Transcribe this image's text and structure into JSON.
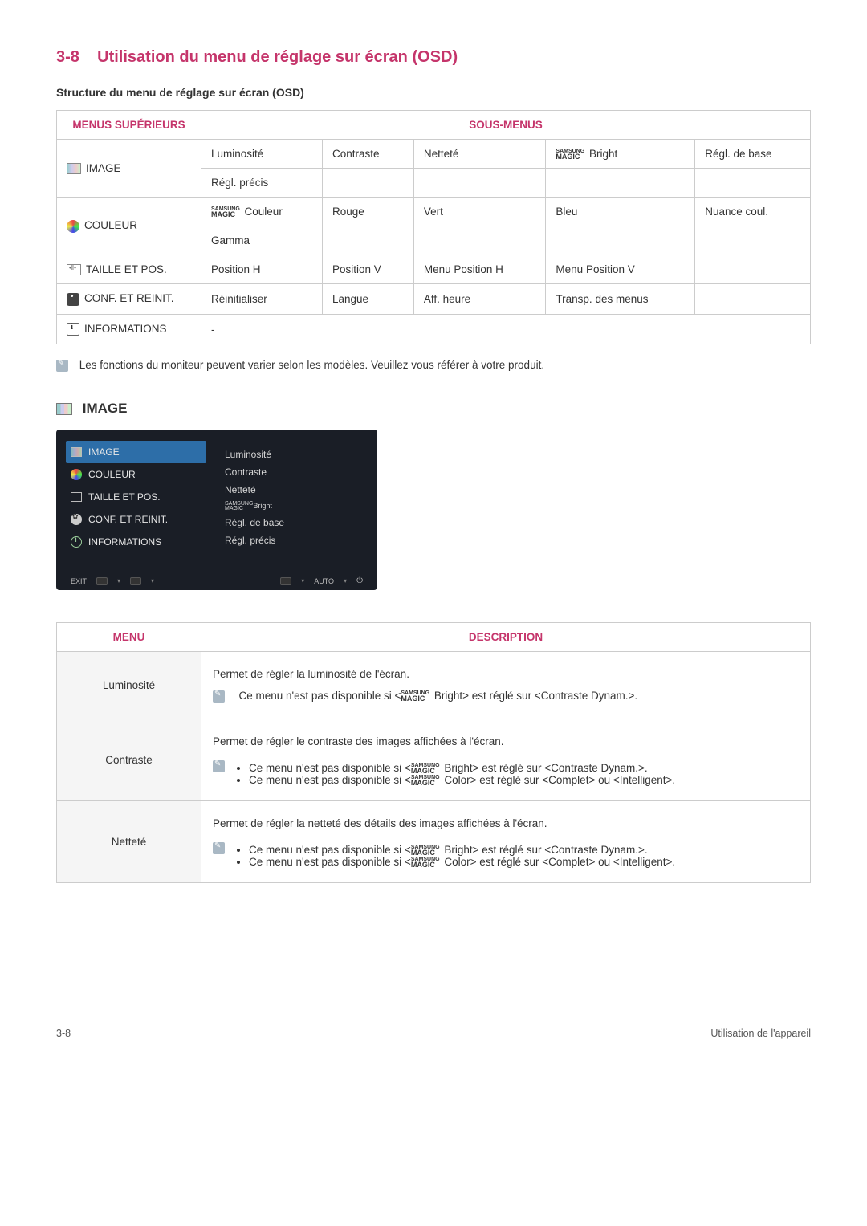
{
  "header": {
    "section_number": "3-8",
    "section_title": "Utilisation du menu de réglage sur écran (OSD)",
    "sub_heading": "Structure du menu de réglage sur écran (OSD)"
  },
  "table_headers": {
    "col1": "MENUS SUPÉRIEURS",
    "col2": "SOUS-MENUS"
  },
  "menus": {
    "image": {
      "label": "IMAGE",
      "row1": [
        "Luminosité",
        "Contraste",
        "Netteté",
        " Bright",
        "Régl. de base"
      ],
      "row2": [
        "Régl. précis",
        "",
        "",
        "",
        ""
      ]
    },
    "couleur": {
      "label": "COULEUR",
      "row1": [
        " Couleur",
        "Rouge",
        "Vert",
        "Bleu",
        "Nuance coul."
      ],
      "row2": [
        "Gamma",
        "",
        "",
        "",
        ""
      ]
    },
    "taille": {
      "label": "TAILLE ET POS.",
      "row1": [
        "Position H",
        "Position V",
        "Menu Position H",
        "Menu Position V",
        ""
      ]
    },
    "conf": {
      "label": "CONF. ET REINIT.",
      "row1": [
        "Réinitialiser",
        "Langue",
        "Aff. heure",
        "Transp. des menus",
        ""
      ]
    },
    "info": {
      "label": "INFORMATIONS",
      "row1": [
        "-",
        "",
        "",
        "",
        ""
      ]
    }
  },
  "note": "Les fonctions du moniteur peuvent varier selon les modèles. Veuillez vous référer à votre produit.",
  "image_section_title": "IMAGE",
  "osd": {
    "left": [
      "IMAGE",
      "COULEUR",
      "TAILLE ET POS.",
      "CONF. ET REINIT.",
      "INFORMATIONS"
    ],
    "right": [
      "Luminosité",
      "Contraste",
      "Netteté",
      "Bright",
      "Régl. de base",
      "Régl. précis"
    ],
    "bottom_left": "EXIT",
    "bottom_right_auto": "AUTO"
  },
  "table2_headers": {
    "menu": "MENU",
    "desc": "DESCRIPTION"
  },
  "desc_rows": {
    "lum": {
      "menu": "Luminosité",
      "p1": "Permet de régler la luminosité de l'écran.",
      "p2": "Ce menu n'est pas disponible si < Bright> est réglé sur <Contraste Dynam.>."
    },
    "con": {
      "menu": "Contraste",
      "p1": "Permet de régler le contraste des images affichées à l'écran.",
      "b1": "Ce menu n'est pas disponible si < Bright> est réglé sur <Contraste Dynam.>.",
      "b2": "Ce menu n'est pas disponible si < Color> est réglé sur <Complet> ou <Intelligent>."
    },
    "net": {
      "menu": "Netteté",
      "p1": "Permet de régler la netteté des détails des images affichées à l'écran.",
      "b1": "Ce menu n'est pas disponible si < Bright> est réglé sur <Contraste Dynam.>.",
      "b2": "Ce menu n'est pas disponible si < Color> est réglé sur <Complet> ou <Intelligent>."
    }
  },
  "magic_label": {
    "samsung": "SAMSUNG",
    "magic": "MAGIC"
  },
  "footer": {
    "left": "3-8",
    "right": "Utilisation de l'appareil"
  }
}
